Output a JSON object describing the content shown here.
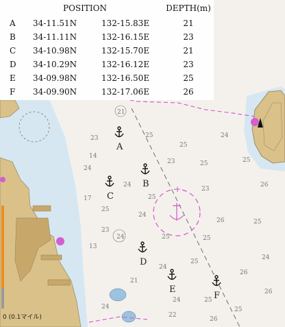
{
  "table": {
    "headers": {
      "position": "POSITION",
      "depth": "DEPTH(m)"
    },
    "rows": [
      {
        "id": "A",
        "lat": "34-11.51N",
        "lon": "132-15.83E",
        "depth": "21"
      },
      {
        "id": "B",
        "lat": "34-11.11N",
        "lon": "132-16.15E",
        "depth": "23"
      },
      {
        "id": "C",
        "lat": "34-10.98N",
        "lon": "132-15.70E",
        "depth": "21"
      },
      {
        "id": "D",
        "lat": "34-10.29N",
        "lon": "132-16.12E",
        "depth": "23"
      },
      {
        "id": "E",
        "lat": "34-09.98N",
        "lon": "132-16.50E",
        "depth": "25"
      },
      {
        "id": "F",
        "lat": "34-09.90N",
        "lon": "132-17.06E",
        "depth": "26"
      }
    ]
  },
  "anchor_labels": [
    "A",
    "B",
    "C",
    "D",
    "E",
    "F"
  ],
  "soundings": [
    "21",
    "23",
    "24",
    "25",
    "25",
    "23",
    "24",
    "24",
    "25",
    "23",
    "26",
    "26",
    "25",
    "24",
    "25",
    "24",
    "23",
    "25",
    "25",
    "24",
    "26",
    "26",
    "25",
    "24",
    "22",
    "21",
    "17",
    "14",
    "13",
    "25",
    "25",
    "24",
    "25",
    "26",
    "24",
    "25"
  ],
  "scale_caption": "0 (0.1マイル)",
  "colors": {
    "land": "#d9c189",
    "land_dark": "#c7a86a",
    "sea_shallow": "#d7e7f2",
    "sea": "#f4f1ec",
    "restricted": "#d35fcf",
    "anchorage": "#d35fcf",
    "depth_text": "#777777"
  }
}
